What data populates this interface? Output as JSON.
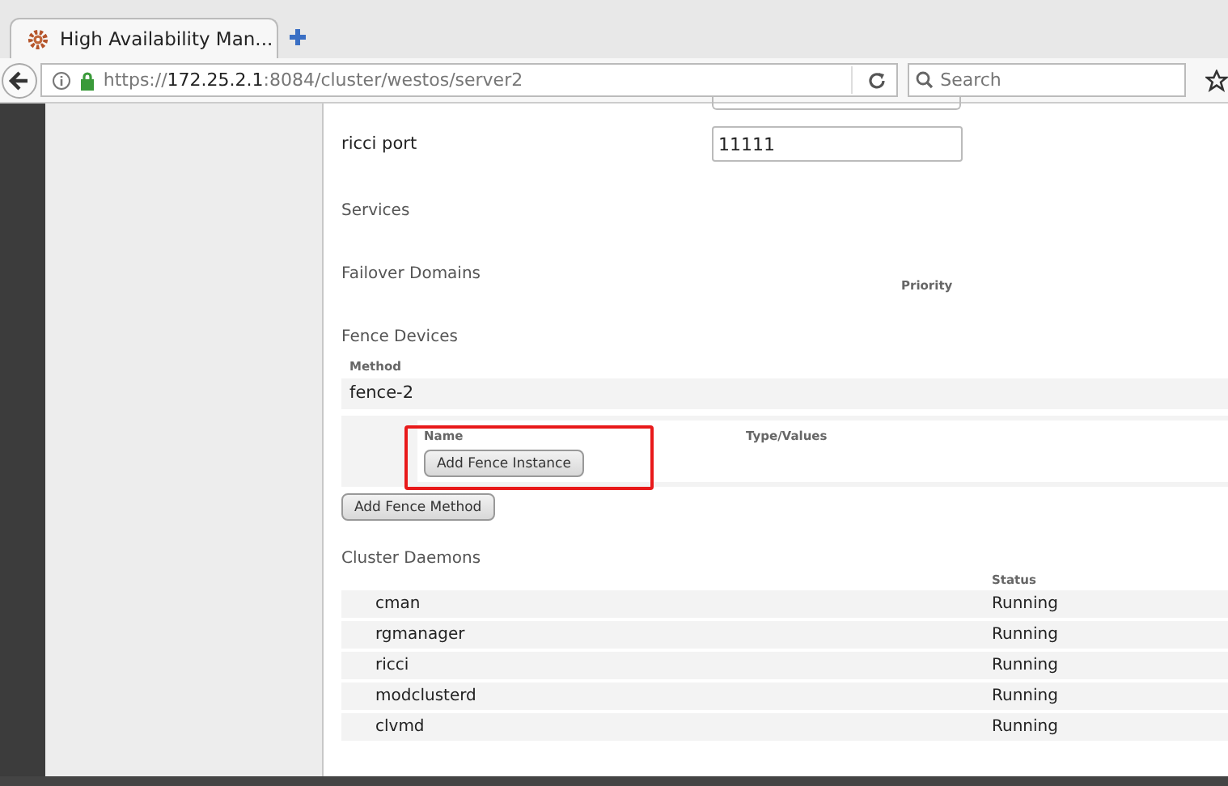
{
  "browser": {
    "tab": {
      "title": "High Availability Man...",
      "selected": true
    },
    "url": {
      "scheme": "https://",
      "host": "172.25.2.1",
      "rest": ":8084/cluster/westos/server2"
    },
    "search": {
      "placeholder": "Search"
    }
  },
  "node": {
    "ricci_port": {
      "label": "ricci port",
      "value": "11111"
    },
    "services": {
      "title": "Services"
    },
    "failover": {
      "title": "Failover Domains",
      "column": "Priority"
    },
    "fence": {
      "title": "Fence Devices",
      "column": "Method",
      "methods": [
        {
          "name": "fence-2",
          "columns": [
            "Name",
            "Type/Values"
          ],
          "button": "Add Fence Instance"
        }
      ],
      "button": "Add Fence Method"
    },
    "daemons": {
      "title": "Cluster Daemons",
      "column": "Status",
      "rows": [
        {
          "name": "cman",
          "status": "Running"
        },
        {
          "name": "rgmanager",
          "status": "Running"
        },
        {
          "name": "ricci",
          "status": "Running"
        },
        {
          "name": "modclusterd",
          "status": "Running"
        },
        {
          "name": "clvmd",
          "status": "Running"
        }
      ]
    }
  }
}
